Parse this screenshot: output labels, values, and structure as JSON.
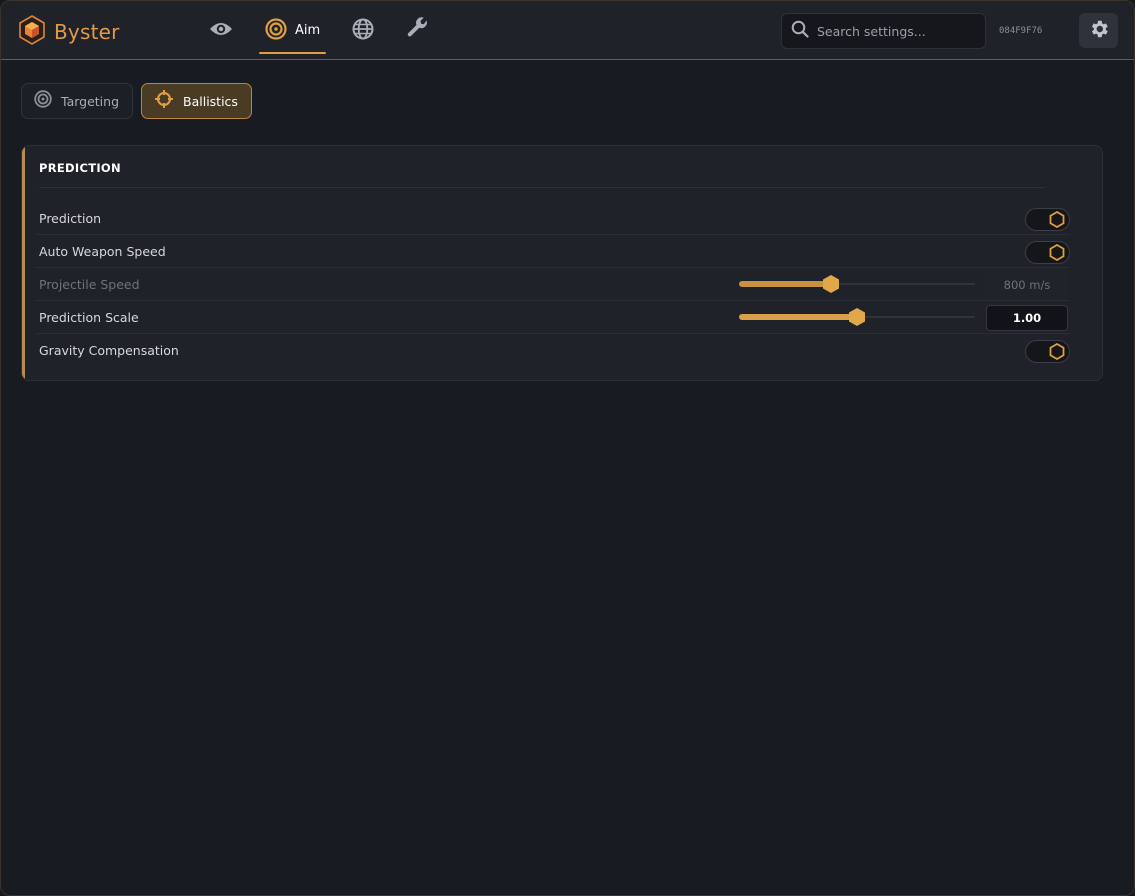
{
  "app": {
    "name": "Byster",
    "hwid": "084F9F76"
  },
  "colors": {
    "accent": "#e0a040",
    "background": "#181b22",
    "panel": "#1f2229"
  },
  "nav": {
    "items": [
      {
        "icon": "eye-icon",
        "label": "",
        "active": false
      },
      {
        "icon": "target-icon",
        "label": "Aim",
        "active": true
      },
      {
        "icon": "globe-icon",
        "label": "",
        "active": false
      },
      {
        "icon": "wrench-icon",
        "label": "",
        "active": false
      }
    ]
  },
  "search": {
    "placeholder": "Search settings...",
    "value": ""
  },
  "subtabs": [
    {
      "label": "Targeting",
      "icon": "target-icon",
      "active": false
    },
    {
      "label": "Ballistics",
      "icon": "crosshair-icon",
      "active": true
    }
  ],
  "section": {
    "title": "PREDICTION",
    "rows": [
      {
        "label": "Prediction",
        "type": "toggle",
        "enabled": true
      },
      {
        "label": "Auto Weapon Speed",
        "type": "toggle",
        "enabled": true
      },
      {
        "label": "Projectile Speed",
        "type": "slider",
        "disabled": true,
        "level": 0.39,
        "value": "800 m/s"
      },
      {
        "label": "Prediction Scale",
        "type": "slider",
        "disabled": false,
        "level": 0.5,
        "value": "1.00"
      },
      {
        "label": "Gravity Compensation",
        "type": "toggle",
        "enabled": true
      }
    ]
  }
}
